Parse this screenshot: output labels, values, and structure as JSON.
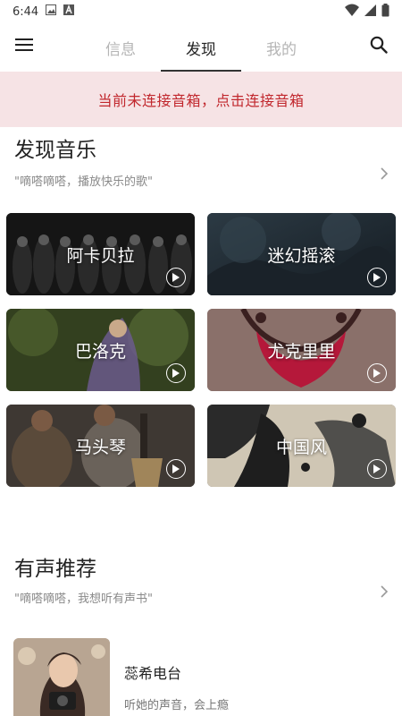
{
  "status_bar": {
    "time": "6:44",
    "left_icons": [
      "image-icon",
      "a-badge-icon"
    ],
    "right_icons": [
      "wifi-icon",
      "signal-icon",
      "battery-icon"
    ]
  },
  "top_nav": {
    "menu_icon": "menu-icon",
    "search_icon": "search-icon",
    "tabs": [
      {
        "label": "信息",
        "active": false
      },
      {
        "label": "发现",
        "active": true
      },
      {
        "label": "我的",
        "active": false
      }
    ]
  },
  "banner": {
    "text": "当前未连接音箱，点击连接音箱",
    "bg_color": "#f6e3e5",
    "text_color": "#c1272d"
  },
  "discover": {
    "title": "发现音乐",
    "subtitle": "\"嘀嗒嘀嗒，播放快乐的歌\"",
    "cards": [
      {
        "label": "阿卡贝拉",
        "color": "#141414"
      },
      {
        "label": "迷幻摇滚",
        "color": "#1e2a33"
      },
      {
        "label": "巴洛克",
        "color": "#3c4a2c"
      },
      {
        "label": "尤克里里",
        "color": "#7a5f58"
      },
      {
        "label": "马头琴",
        "color": "#4a4a4a"
      },
      {
        "label": "中国风",
        "color": "#6b6b6b"
      }
    ]
  },
  "audio": {
    "title": "有声推荐",
    "subtitle": "\"嘀嗒嘀嗒，我想听有声书\"",
    "items": [
      {
        "title": "蕊希电台",
        "desc": "听她的声音，会上瘾"
      }
    ]
  }
}
